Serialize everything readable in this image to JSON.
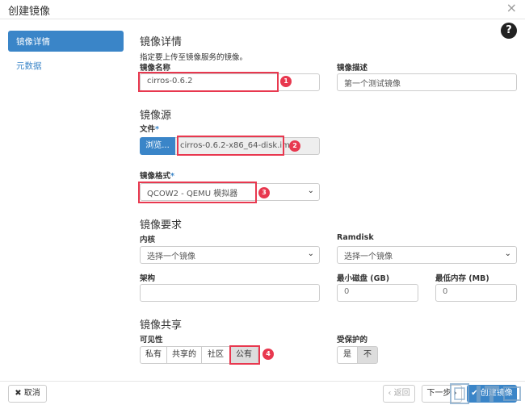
{
  "header": {
    "title": "创建镜像",
    "close_glyph": "×"
  },
  "sidebar": {
    "items": [
      {
        "label": "镜像详情"
      },
      {
        "label": "元数据"
      }
    ]
  },
  "help_glyph": "?",
  "details": {
    "heading": "镜像详情",
    "description": "指定要上传至镜像服务的镜像。",
    "name_label": "镜像名称",
    "name_value": "cirros-0.6.2",
    "desc_label": "镜像描述",
    "desc_value": "第一个测试镜像"
  },
  "source": {
    "heading": "镜像源",
    "file_label": "文件",
    "browse_label": "浏览...",
    "file_name": "cirros-0.6.2-x86_64-disk.img"
  },
  "format": {
    "label": "镜像格式",
    "value": "QCOW2 - QEMU 模拟器"
  },
  "requirements": {
    "heading": "镜像要求",
    "kernel_label": "内核",
    "kernel_value": "选择一个镜像",
    "ramdisk_label": "Ramdisk",
    "ramdisk_value": "选择一个镜像",
    "arch_label": "架构",
    "arch_value": "",
    "min_disk_label": "最小磁盘 (GB)",
    "min_disk_value": "0",
    "min_ram_label": "最低内存 (MB)",
    "min_ram_value": "0"
  },
  "sharing": {
    "heading": "镜像共享",
    "visibility_label": "可见性",
    "visibility_options": [
      "私有",
      "共享的",
      "社区",
      "公有"
    ],
    "visibility_selected": "公有",
    "protected_label": "受保护的",
    "protected_options": [
      "是",
      "不"
    ],
    "protected_selected": "不"
  },
  "callouts": [
    "1",
    "2",
    "3",
    "4"
  ],
  "footer": {
    "cancel": "✖ 取消",
    "back": "‹ 返回",
    "next": "下一步 ›",
    "create": "✔ 创建镜像"
  },
  "colors": {
    "primary": "#3a85c8",
    "highlight": "#e8384f"
  }
}
